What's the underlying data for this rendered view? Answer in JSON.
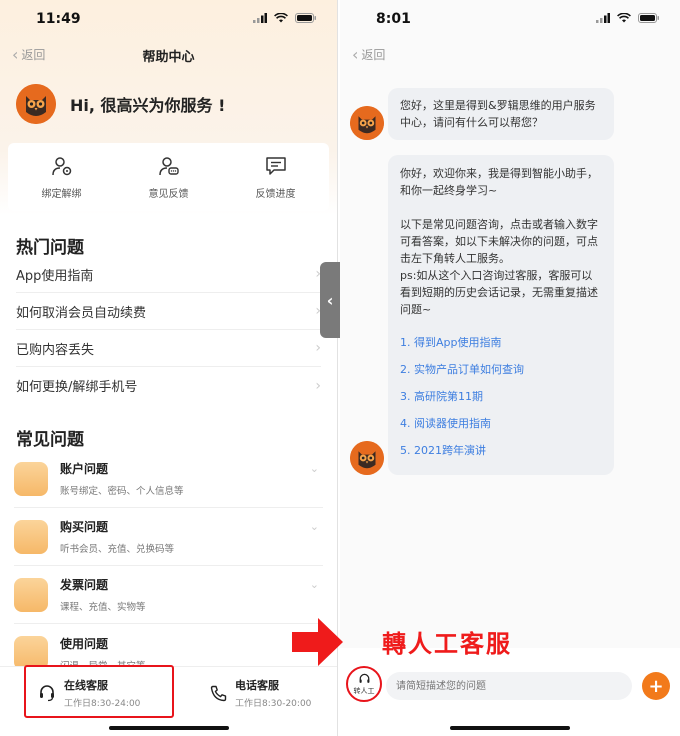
{
  "left_screen": {
    "status": {
      "time": "11:49"
    },
    "nav": {
      "back_label": "返回",
      "title": "帮助中心"
    },
    "greeting": "Hi, 很高兴为你服务 !",
    "quick_actions": [
      {
        "label": "绑定解绑",
        "icon": "user-gear-icon"
      },
      {
        "label": "意见反馈",
        "icon": "user-chat-icon"
      },
      {
        "label": "反馈进度",
        "icon": "message-list-icon"
      }
    ],
    "hot_title": "热门问题",
    "hot_questions": [
      "App使用指南",
      "如何取消会员自动续费",
      "已购内容丢失",
      "如何更换/解绑手机号"
    ],
    "common_title": "常见问题",
    "common_questions": [
      {
        "title": "账户问题",
        "subtitle": "账号绑定、密码、个人信息等",
        "icon": "account-icon"
      },
      {
        "title": "购买问题",
        "subtitle": "听书会员、充值、兑换码等",
        "icon": "basket-icon"
      },
      {
        "title": "发票问题",
        "subtitle": "课程、充值、实物等",
        "icon": "invoice-icon"
      },
      {
        "title": "使用问题",
        "subtitle": "闪退、异常、其它等",
        "icon": "usage-icon"
      }
    ],
    "bottom": {
      "online": {
        "title": "在线客服",
        "hours": "工作日8:30-24:00"
      },
      "phone": {
        "title": "电话客服",
        "hours": "工作日8:30-20:00"
      }
    }
  },
  "right_screen": {
    "status": {
      "time": "8:01"
    },
    "nav": {
      "back_label": "返回"
    },
    "message1": "您好，这里是得到&罗辑思维的用户服务中心，请问有什么可以帮您？",
    "message2": {
      "intro": "你好，欢迎你来，我是得到智能小助手，和你一起终身学习~",
      "body": "以下是常见问题咨询，点击或者输入数字可看答案，如以下未解决你的问题，可点击左下角转人工服务。",
      "ps": "ps:如从这个入口咨询过客服，客服可以看到短期的历史会话记录，无需重复描述问题~",
      "links": [
        "1. 得到App使用指南",
        "2. 实物产品订单如何查询",
        "3. 高研院第11期",
        "4. 阅读器使用指南",
        "5. 2021跨年演讲"
      ]
    },
    "annotation": "轉人工客服",
    "input": {
      "human_label": "转人工",
      "placeholder": "请简短描述您的问题",
      "plus": "+"
    }
  },
  "colors": {
    "accent": "#f27a1b",
    "annotation_red": "#e8141b",
    "link": "#3d7ee0"
  }
}
